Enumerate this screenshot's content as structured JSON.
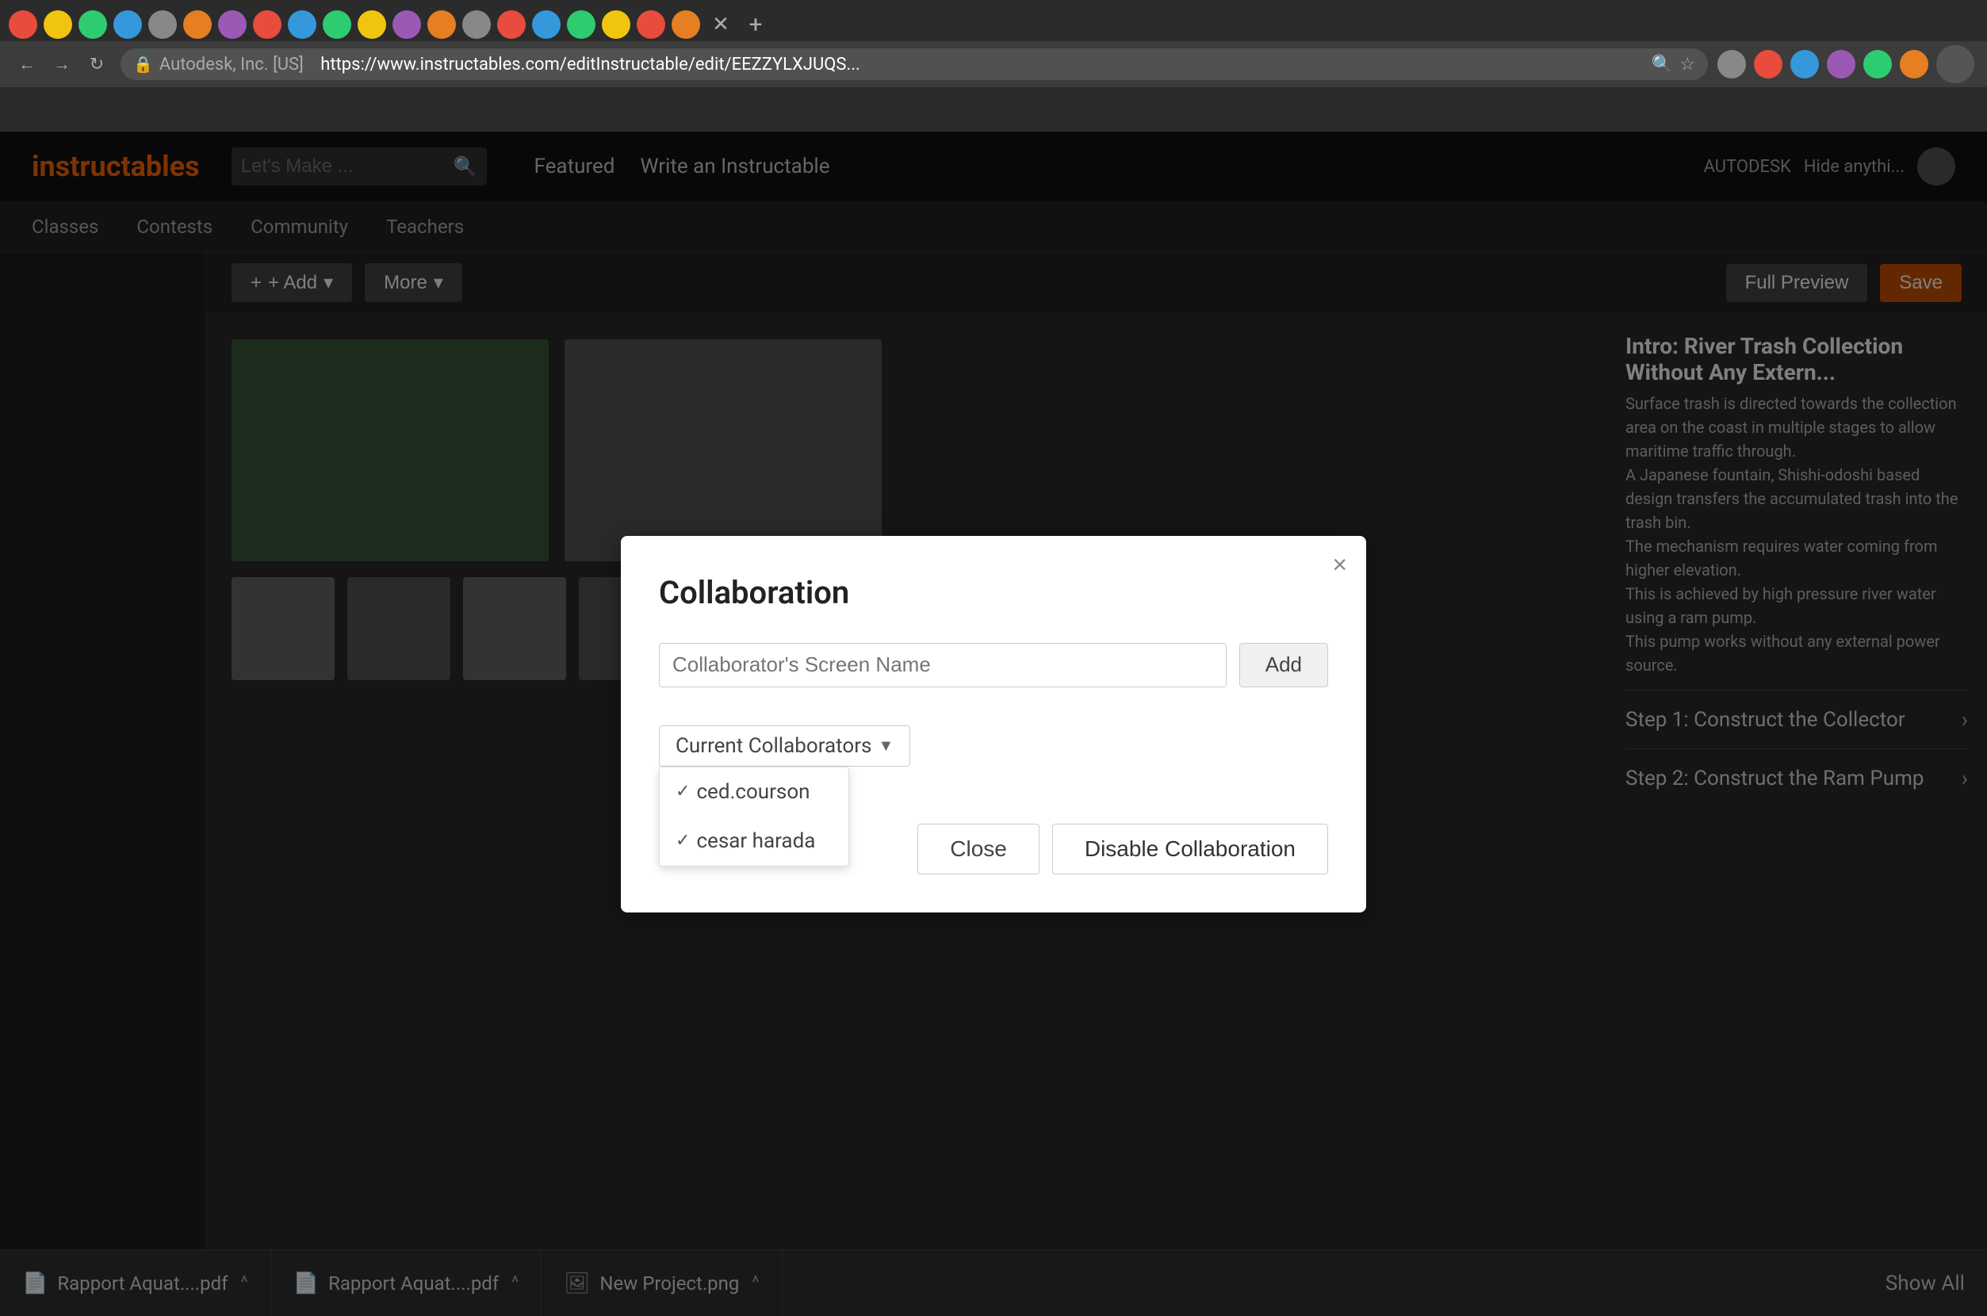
{
  "browser": {
    "url": "https://www.instructables.com/editInstructable/edit/EEZZYLXJUQS...",
    "company": "Autodesk, Inc. [US]",
    "search_placeholder": "Let's Make ...",
    "back_label": "←",
    "forward_label": "→",
    "reload_label": "↻"
  },
  "site": {
    "logo": "instructables",
    "nav_items": [
      "Featured",
      "Write an Instructable"
    ],
    "sub_nav_items": [
      "Classes",
      "Contests",
      "Community",
      "Teachers"
    ],
    "autodesk_label": "AUTODESK",
    "hide_label": "Hide anythi..."
  },
  "editor": {
    "add_btn": "+ Add",
    "more_btn": "More",
    "full_preview_btn": "Full Preview",
    "save_btn": "Save"
  },
  "content": {
    "intro_title": "Intro: River Trash Collection Without Any Extern...",
    "intro_desc": "Surface trash is directed towards the collection area on the coast in multiple stages to allow maritime traffic through.\nA Japanese fountain, Shishi-odoshi based design transfers the accumulated trash into the trash bin.\nThe mechanism requires water coming from higher elevation.\nThis is achieved by high pressure river water using a ram pump.\nThis pump works without any external power source.",
    "step1": "Step 1: Construct the Collector",
    "step2": "Step 2: Construct the Ram Pump"
  },
  "modal": {
    "title": "Collaboration",
    "close_label": "×",
    "input_placeholder": "Collaborator's Screen Name",
    "add_btn": "Add",
    "dropdown_label": "Current Collaborators",
    "dropdown_arrow": "▼",
    "collaborators": [
      {
        "name": "ced.courson",
        "check": "✓"
      },
      {
        "name": "cesar harada",
        "check": "✓"
      }
    ],
    "close_btn": "Close",
    "disable_btn": "Disable Collaboration"
  },
  "bottom_bar": {
    "items": [
      {
        "name": "Rapport Aquat....pdf",
        "icon": "📄"
      },
      {
        "name": "Rapport Aquat....pdf",
        "icon": "📄"
      },
      {
        "name": "New Project.png",
        "icon": "🖼"
      }
    ],
    "show_all_label": "Show All"
  }
}
